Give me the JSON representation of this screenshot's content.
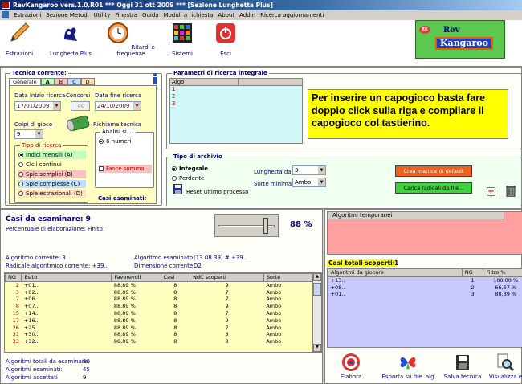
{
  "window": {
    "title": "RevKangaroo vers.1.0.R01  ***  Oggi 31 ott 2009  ***  [Sezione Lunghetta Plus]"
  },
  "menu": [
    "Estrazioni",
    "Sezione Metodi",
    "Utility",
    "Finestra",
    "Guida",
    "Moduli a richiesta",
    "About",
    "Addin",
    "Ricerca aggiornamenti"
  ],
  "toolbar": {
    "estrazioni": "Estrazioni",
    "lunghetta": "Lunghetta Plus",
    "ritardi": "Ritardi e frequenze",
    "sistemi": "Sistemi",
    "esci": "Esci",
    "logo_top": "Rev",
    "logo_bottom": "Kangaroo",
    "logo_badge": "RK"
  },
  "tecnica": {
    "title": "Tecnica corrente:",
    "tabs": [
      "Generale",
      "A",
      "B",
      "C",
      "D"
    ],
    "data_inizio_label": "Data inizio ricerca",
    "data_inizio": "17/01/2009",
    "concorsi_label": "Concorsi",
    "concorsi": "40",
    "data_fine_label": "Data fine ricerca",
    "data_fine": "24/10/2009",
    "colpi_label": "Colpi di gioco",
    "colpi": "9",
    "richiama": "Richiama tecnica",
    "tipo_title": "Tipo di ricerca",
    "tipi": [
      "Indici mensili (A)",
      "Cicli continui",
      "Spie semplici (B)",
      "Spie complesse (C)",
      "Spie estrazionali (D)"
    ],
    "analisi_title": "Analisi su...",
    "analisi_opt": "6 numeri",
    "fasce": "Fasce somma",
    "casi_esaminati": "Casi esaminati:"
  },
  "parametri": {
    "title": "Parametri di ricerca integrale",
    "col": "Algo",
    "rows": [
      "1",
      "2",
      "3"
    ],
    "info": "Per inserire un capogioco basta fare doppio click sulla riga e compilare il capogioco col tastierino."
  },
  "archivio": {
    "title": "Tipo di archivio",
    "opt1": "Integrale",
    "opt2": "Perdente",
    "reset": "Reset ultimo processo",
    "lunghetta_label": "Lunghetta da",
    "lunghetta_val": "3",
    "sorte_label": "Sorte minima",
    "sorte_val": "Ambo",
    "crea": "Crea matrice di default",
    "carica": "Carica radicali da file..."
  },
  "casi": {
    "title": "Casi da esaminare: 9",
    "perc_label": "Percentuale di elaborazione:",
    "perc_val": "Finito!",
    "percent": "88 %",
    "slider_fraction": 0.88,
    "alg_corr": "Algoritmo corrente: 3",
    "rad_corr": "Radicale algoritmico corrente: +39..",
    "alg_esam": "Algoritmo esaminato:",
    "alg_esam_val": "(13 08 39) # +39..",
    "dim": "Dimensione corrente:",
    "dim_val": "D2",
    "headers": [
      "NG",
      "Esito",
      "Favorevoli",
      "Casi",
      "NdC scoperti",
      "Sorte"
    ],
    "rows": [
      [
        "2",
        "+01..",
        "88,89 %",
        "8",
        "9",
        "Ambo"
      ],
      [
        "3",
        "+02..",
        "88,89 %",
        "8",
        "7",
        "Ambo"
      ],
      [
        "7",
        "+06..",
        "88,89 %",
        "8",
        "7",
        "Ambo"
      ],
      [
        "8",
        "+07..",
        "88,89 %",
        "8",
        "9",
        "Ambo"
      ],
      [
        "15",
        "+14..",
        "88,89 %",
        "8",
        "7",
        "Ambo"
      ],
      [
        "17",
        "+16..",
        "88,89 %",
        "8",
        "9",
        "Ambo"
      ],
      [
        "26",
        "+25..",
        "88,89 %",
        "8",
        "7",
        "Ambo"
      ],
      [
        "31",
        "+30..",
        "88,89 %",
        "8",
        "8",
        "Ambo"
      ],
      [
        "33",
        "+32..",
        "88,89 %",
        "8",
        "8",
        "Ambo"
      ]
    ],
    "tot_label": "Algoritmi totali da esaminare:",
    "tot_val": "50",
    "esam_label": "Algoritmi esaminati:",
    "esam_val": "45",
    "acc_label": "Algoritmi accettati",
    "acc_val": "9"
  },
  "temporanei": {
    "header": "Algoritmi temporanei"
  },
  "scoperti": {
    "label": "Casi totali scoperti:",
    "count": "1",
    "headers": [
      "Algoritmi da giocare",
      "NG",
      "Filtro %"
    ],
    "rows": [
      [
        "+13..",
        "1",
        "100,00 %"
      ],
      [
        "+08..",
        "2",
        "66,67 %"
      ],
      [
        "+01..",
        "3",
        "88,89 %"
      ]
    ]
  },
  "actions": [
    "Elabora",
    "Esporta su file .alg",
    "Salva tecnica",
    "Visualizza es"
  ]
}
